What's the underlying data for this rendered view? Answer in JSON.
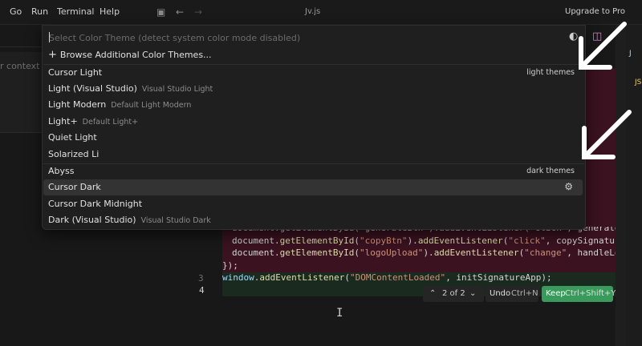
{
  "titlebar": {
    "menu": [
      "Go",
      "Run",
      "Terminal",
      "Help"
    ],
    "window_title": "Jv.js",
    "upgrade_label": "Upgrade to Pro"
  },
  "left_pane": {
    "context_label": "r context"
  },
  "right_panel": {
    "tab_js": "J",
    "tab_js2": "JS"
  },
  "quick_pick": {
    "placeholder": "Select Color Theme (detect system color mode disabled)",
    "browse_label": "Browse Additional Color Themes...",
    "items": [
      {
        "label": "Cursor Light",
        "desc": "",
        "group": "light themes"
      },
      {
        "label": "Light (Visual Studio)",
        "desc": "Visual Studio Light",
        "group": ""
      },
      {
        "label": "Light Modern",
        "desc": "Default Light Modern",
        "group": ""
      },
      {
        "label": "Light+",
        "desc": "Default Light+",
        "group": ""
      },
      {
        "label": "Quiet Light",
        "desc": "",
        "group": ""
      },
      {
        "label": "Solarized Li",
        "desc": "",
        "group": ""
      },
      {
        "label": "Abyss",
        "desc": "",
        "group": "dark themes"
      },
      {
        "label": "Cursor Dark",
        "desc": "",
        "group": ""
      },
      {
        "label": "Cursor Dark Midnight",
        "desc": "",
        "group": ""
      },
      {
        "label": "Dark (Visual Studio)",
        "desc": "Visual Studio Dark",
        "group": ""
      }
    ],
    "selected_index": 7
  },
  "editor": {
    "partial_line": "document.getElementById(\"generateBtn\").addEventListener(\"click\", generateSign",
    "lines": [
      {
        "pre": "document.",
        "fn": "getElementById",
        "a": "(",
        "s1": "\"copyBtn\"",
        "b": ").",
        "fn2": "addEventListener",
        "c": "(",
        "s2": "\"click\"",
        "d": ", copySignature);"
      },
      {
        "pre": "document.",
        "fn": "getElementById",
        "a": "(",
        "s1": "\"logoUpload\"",
        "b": ").",
        "fn2": "addEventListener",
        "c": "(",
        "s2": "\"change\"",
        "d": ", handleLogoUp"
      }
    ],
    "closing": "});",
    "line3_no": "3",
    "line4_no": "4",
    "line3": {
      "obj": "window",
      "dot": ".",
      "fn": "addEventListener",
      "a": "(",
      "s": "\"DOMContentLoaded\"",
      "b": ", initSignatureApp);"
    }
  },
  "diff_toolbar": {
    "counter": "2 of 2",
    "undo_label": "Undo",
    "undo_key": "Ctrl+N",
    "keep_label": "Keep",
    "keep_key": "Ctrl+Shift+Y"
  },
  "colors": {
    "background": "#141414",
    "diff_removed": "#3a1220",
    "diff_added": "#1b2a1f",
    "keep_button": "#3a9a5c",
    "arrow": "#ffffff"
  }
}
